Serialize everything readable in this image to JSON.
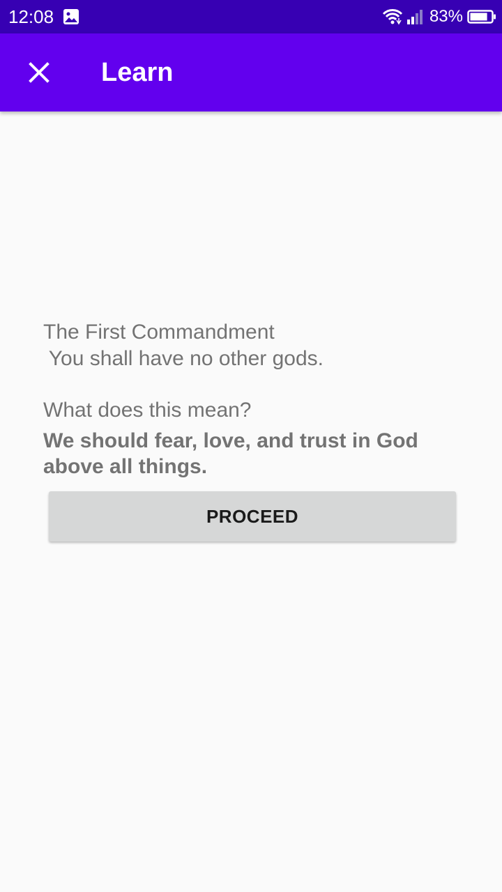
{
  "status_bar": {
    "time": "12:08",
    "battery_percent": "83%",
    "icons": [
      "gallery-icon",
      "wifi-icon",
      "signal-icon",
      "battery-icon"
    ],
    "battery_level": 0.83
  },
  "app_bar": {
    "title": "Learn",
    "close_icon": "close-icon"
  },
  "lesson": {
    "title": "The First Commandment",
    "commandment": " You shall have no other gods.",
    "question": "What does this mean?",
    "answer": "We should fear, love, and trust in God above all things."
  },
  "actions": {
    "proceed_label": "PROCEED"
  },
  "colors": {
    "status_bar": "#3700b3",
    "app_bar": "#6200ee",
    "background": "#fafafa",
    "text_gray": "#737373",
    "button_bg": "#d6d7d7"
  }
}
